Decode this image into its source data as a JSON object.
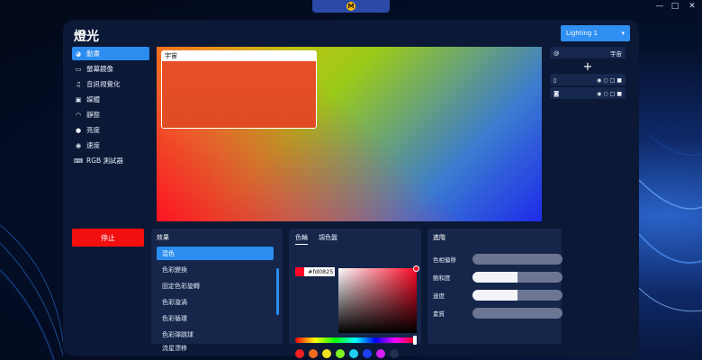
{
  "app": {
    "title": "燈光",
    "logo_letter": "M",
    "dropdown_value": "Lighting 1"
  },
  "window_controls": [
    "—",
    "□",
    "✕"
  ],
  "nav": {
    "items": [
      {
        "label": "動畫",
        "icon": "palette-icon",
        "active": true
      },
      {
        "label": "螢幕鏡像",
        "icon": "monitor-icon",
        "active": false
      },
      {
        "label": "音訊視覺化",
        "icon": "music-note-icon",
        "active": false
      },
      {
        "label": "媒體",
        "icon": "media-icon",
        "active": false
      },
      {
        "label": "靜態",
        "icon": "rainbow-icon",
        "active": false
      },
      {
        "label": "亮度",
        "icon": "bulb-icon",
        "active": false
      },
      {
        "label": "速度",
        "icon": "gauge-icon",
        "active": false
      },
      {
        "label": "RGB 測試器",
        "icon": "keyboard-icon",
        "active": false
      }
    ]
  },
  "canvas": {
    "zone_label": "宇宙"
  },
  "right_panel": {
    "layer_label": "宇宙",
    "add_label": "+",
    "devices": [
      {
        "icon": "tower-icon"
      },
      {
        "icon": "device-m-icon"
      }
    ]
  },
  "stop_button": "停止",
  "effects": {
    "header": "效果",
    "items": [
      "混色",
      "色彩變換",
      "固定色彩旋轉",
      "色彩漩渦",
      "色彩循環",
      "色彩彈跳球",
      "流星漂移"
    ],
    "active_index": 0
  },
  "color_panel": {
    "tabs": [
      "色輪",
      "調色盤"
    ],
    "active_tab": 0,
    "hex_value": "#fd0825",
    "current_color": "#fd0825",
    "presets": [
      "#f21f1f",
      "#f26b1f",
      "#f2e21f",
      "#7ef21f",
      "#1fd0f2",
      "#1f3ff2",
      "#d41ff2",
      "#22304f"
    ]
  },
  "advanced": {
    "header": "進階",
    "sliders": [
      {
        "label": "色相偏移",
        "value": 0
      },
      {
        "label": "飽和度",
        "value": 0.5
      },
      {
        "label": "速度",
        "value": 0.5
      },
      {
        "label": "素質",
        "value": 0
      }
    ]
  }
}
